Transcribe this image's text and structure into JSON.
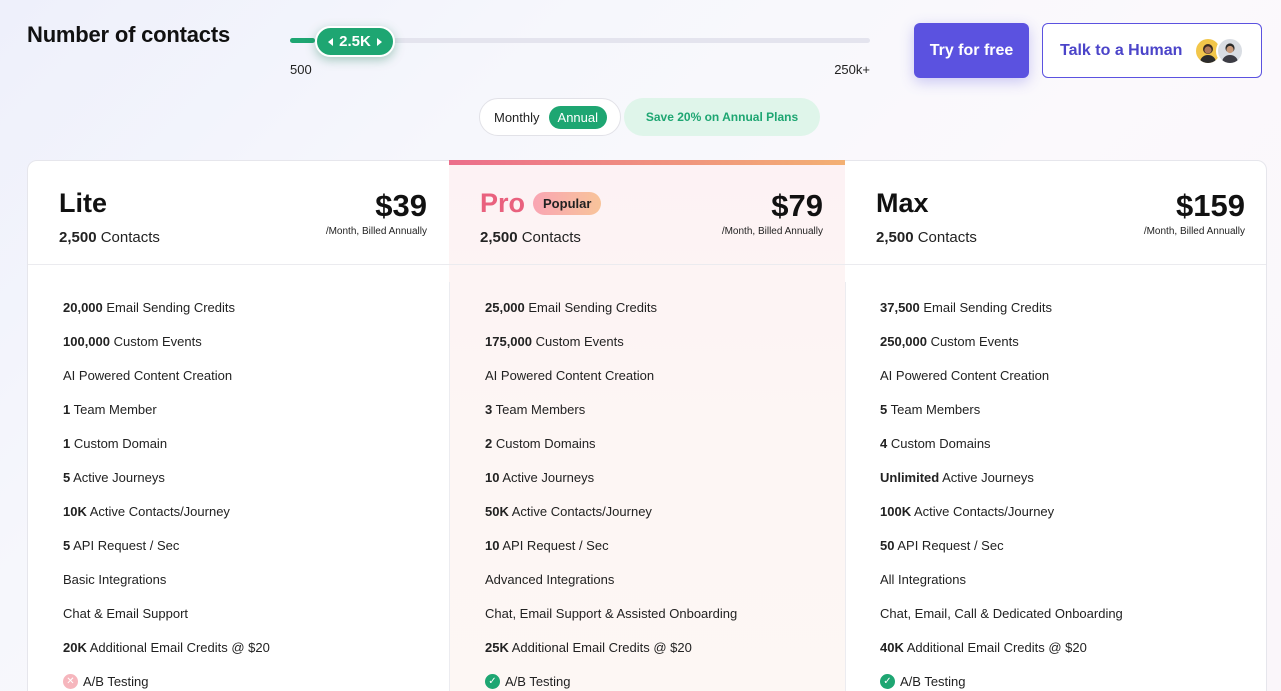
{
  "header": {
    "title": "Number of contacts",
    "slider": {
      "value_label": "2.5K",
      "min_label": "500",
      "max_label": "250k+",
      "fill_fraction": 0.05
    },
    "try_button": "Try for free",
    "talk_button": "Talk to a Human"
  },
  "billing": {
    "monthly_label": "Monthly",
    "annual_label": "Annual",
    "selected": "Annual",
    "save_note": "Save 20% on Annual Plans"
  },
  "colors": {
    "accent": "#5b52e0",
    "green": "#1ea672",
    "pro": "#e9617e"
  },
  "plans": [
    {
      "name": "Lite",
      "contacts_num": "2,500",
      "contacts_word": "Contacts",
      "price": "$39",
      "per": "/Month, Billed Annually",
      "features": [
        {
          "b": "20,000",
          "t": " Email Sending Credits"
        },
        {
          "b": "100,000",
          "t": " Custom Events"
        },
        {
          "b": "",
          "t": "AI Powered Content Creation"
        },
        {
          "b": "1",
          "t": " Team Member"
        },
        {
          "b": "1",
          "t": " Custom Domain"
        },
        {
          "b": "5",
          "t": " Active Journeys"
        },
        {
          "b": "10K",
          "t": " Active Contacts/Journey"
        },
        {
          "b": "5",
          "t": " API Request / Sec"
        },
        {
          "b": "",
          "t": "Basic Integrations"
        },
        {
          "b": "",
          "t": "Chat & Email Support"
        },
        {
          "b": "20K",
          "t": " Additional Email Credits @ $20"
        },
        {
          "b": "",
          "t": "A/B Testing",
          "check": "no"
        }
      ]
    },
    {
      "name": "Pro",
      "badge": "Popular",
      "contacts_num": "2,500",
      "contacts_word": "Contacts",
      "price": "$79",
      "per": "/Month, Billed Annually",
      "features": [
        {
          "b": "25,000",
          "t": " Email Sending Credits"
        },
        {
          "b": "175,000",
          "t": " Custom Events"
        },
        {
          "b": "",
          "t": "AI Powered Content Creation"
        },
        {
          "b": "3",
          "t": " Team Members"
        },
        {
          "b": "2",
          "t": " Custom Domains"
        },
        {
          "b": "10",
          "t": " Active Journeys"
        },
        {
          "b": "50K",
          "t": " Active Contacts/Journey"
        },
        {
          "b": "10",
          "t": " API Request / Sec"
        },
        {
          "b": "",
          "t": "Advanced Integrations"
        },
        {
          "b": "",
          "t": "Chat, Email Support & Assisted Onboarding"
        },
        {
          "b": "25K",
          "t": " Additional Email Credits @ $20"
        },
        {
          "b": "",
          "t": "A/B Testing",
          "check": "yes"
        }
      ]
    },
    {
      "name": "Max",
      "contacts_num": "2,500",
      "contacts_word": "Contacts",
      "price": "$159",
      "per": "/Month, Billed Annually",
      "features": [
        {
          "b": "37,500",
          "t": " Email Sending Credits"
        },
        {
          "b": "250,000",
          "t": " Custom Events"
        },
        {
          "b": "",
          "t": "AI Powered Content Creation"
        },
        {
          "b": "5",
          "t": " Team Members"
        },
        {
          "b": "4",
          "t": " Custom Domains"
        },
        {
          "b": "Unlimited",
          "t": " Active Journeys"
        },
        {
          "b": "100K",
          "t": " Active Contacts/Journey"
        },
        {
          "b": "50",
          "t": " API Request / Sec"
        },
        {
          "b": "",
          "t": "All Integrations"
        },
        {
          "b": "",
          "t": "Chat, Email, Call & Dedicated Onboarding"
        },
        {
          "b": "40K",
          "t": " Additional Email Credits @ $20"
        },
        {
          "b": "",
          "t": "A/B Testing",
          "check": "yes"
        }
      ]
    }
  ]
}
